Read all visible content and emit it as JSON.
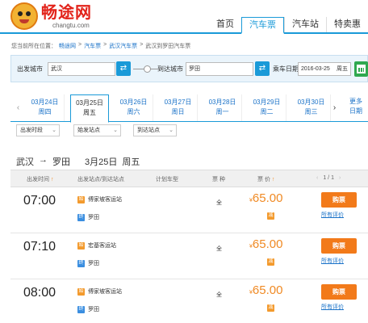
{
  "logo": {
    "name_cn": "畅途网",
    "name_en": "changtu.com"
  },
  "nav": [
    {
      "label": "首页",
      "active": false
    },
    {
      "label": "汽车票",
      "active": true
    },
    {
      "label": "汽车站",
      "active": false
    },
    {
      "label": "特卖惠",
      "active": false
    }
  ],
  "breadcrumb": {
    "prefix": "您当前所在位置：",
    "items": [
      "畅途网",
      "汽车票",
      "武汉汽车票",
      "武汉到罗田汽车票"
    ],
    "separator": ">"
  },
  "search": {
    "from_label": "出发城市",
    "from_value": "武汉",
    "to_label": "到达城市",
    "to_value": "罗田",
    "date_label": "乘车日期",
    "date_value": "2016-03-25",
    "weekday": "周五"
  },
  "dates": [
    {
      "date": "03月24日",
      "weekday": "周四",
      "active": false
    },
    {
      "date": "03月25日",
      "weekday": "周五",
      "active": true
    },
    {
      "date": "03月26日",
      "weekday": "周六",
      "active": false
    },
    {
      "date": "03月27日",
      "weekday": "周日",
      "active": false
    },
    {
      "date": "03月28日",
      "weekday": "周一",
      "active": false
    },
    {
      "date": "03月29日",
      "weekday": "周二",
      "active": false
    },
    {
      "date": "03月30日",
      "weekday": "周三",
      "active": false
    }
  ],
  "more_dates": {
    "line1": "更多",
    "line2": "日期"
  },
  "filters": [
    "出发时段",
    "始发站点",
    "到达站点"
  ],
  "route": {
    "from": "武汉",
    "arrow": "→",
    "to": "罗田",
    "date": "3月25日",
    "weekday": "周五"
  },
  "table_headers": {
    "dep_time": "出发时间",
    "stations": "出发站点/到达站点",
    "model": "计划车型",
    "ticket_type": "票 种",
    "price": "票 价",
    "page": "1 / 1"
  },
  "rows": [
    {
      "time": "07:00",
      "dep_station": "傅家坡客运站",
      "arr_station": "罗田",
      "ticket_type": "全",
      "price": "65.00",
      "discount": "减",
      "buy_label": "购票",
      "eval_label": "所有评价"
    },
    {
      "time": "07:10",
      "dep_station": "宏基客运站",
      "arr_station": "罗田",
      "ticket_type": "全",
      "price": "65.00",
      "discount": "减",
      "buy_label": "购票",
      "eval_label": "所有评价"
    },
    {
      "time": "08:00",
      "dep_station": "傅家坡客运站",
      "arr_station": "罗田",
      "ticket_type": "全",
      "price": "65.00",
      "discount": "减",
      "buy_label": "购票",
      "eval_label": "所有评价"
    }
  ],
  "icons": {
    "dep_badge": "始",
    "arr_badge": "终",
    "yen": "¥",
    "sort_up": "↑",
    "swap": "⇄",
    "prev": "‹",
    "next": "›",
    "chevron": "⌄"
  },
  "colors": {
    "accent": "#1a9ad8",
    "price": "#f08a24",
    "buy": "#f27a1a",
    "logo_red": "#e2231a"
  }
}
